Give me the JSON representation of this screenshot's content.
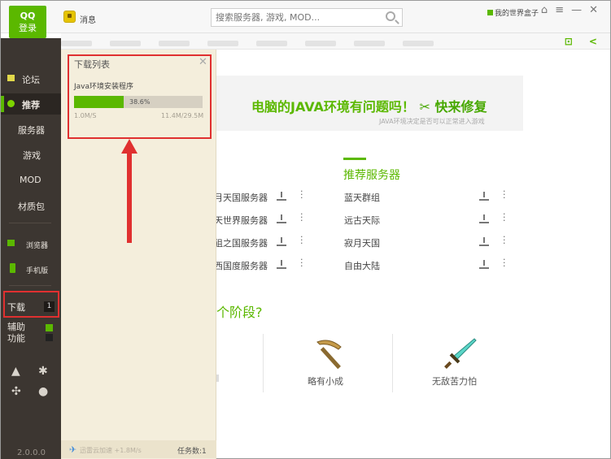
{
  "header": {
    "login_line1": "QQ",
    "login_line2": "登录",
    "messages_label": "消息",
    "search_placeholder": "搜索服务器, 游戏, MOD...",
    "user_link": "我的世界盒子"
  },
  "sidebar": {
    "items": [
      {
        "label": "论坛",
        "icon": "forum-icon"
      },
      {
        "label": "推荐",
        "icon": "recommend-icon",
        "active": true
      },
      {
        "label": "服务器"
      },
      {
        "label": "游戏"
      },
      {
        "label": "MOD"
      },
      {
        "label": "材质包"
      },
      {
        "label": "浏览器",
        "icon": "browser-icon"
      },
      {
        "label": "手机版",
        "icon": "phone-icon"
      }
    ],
    "download_label": "下载",
    "download_count": "1",
    "assist_line1": "辅助",
    "assist_line2": "功能",
    "version": "2.0.0.0"
  },
  "download_panel": {
    "title": "下载列表",
    "item_name": "Java环境安装程序",
    "progress_percent": 38.6,
    "progress_text": "38.6%",
    "speed": "1.0M/S",
    "size": "11.4M/29.5M",
    "accelerator": "迅雷云加速 +1.8M/s",
    "task_count": "任务数:1"
  },
  "main": {
    "banner_text": "电脑的JAVA环境有问题吗！",
    "banner_fix": "快来修复",
    "banner_sub": "JAVA环境决定是否可以正常进入游戏",
    "recommended_title": "推荐服务器",
    "servers_left": [
      "月天国服务器",
      "天世界服务器",
      "狙之国服务器",
      "西国度服务器"
    ],
    "servers_right": [
      "蓝天群组",
      "远古天际",
      "寂月天国",
      "自由大陆"
    ],
    "stage_question": "个阶段?",
    "tools": [
      "略有小成",
      "无敌苦力怕"
    ]
  },
  "colors": {
    "accent": "#5bb800",
    "sidebar": "#3c3631",
    "panel": "#f4eedc",
    "highlight": "#e03030"
  }
}
